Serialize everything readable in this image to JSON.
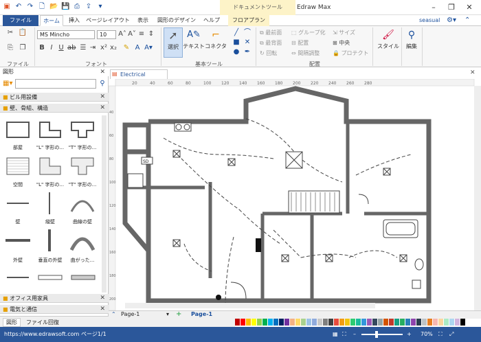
{
  "titlebar": {
    "doc_tools": "ドキュメントツール",
    "app_title": "Edraw Max",
    "user": "seasual"
  },
  "tabs": [
    "ファイル",
    "ホーム",
    "挿入",
    "ページレイアウト",
    "表示",
    "図形のデザイン",
    "ヘルプ",
    "フロアプラン"
  ],
  "ribbon": {
    "font_name": "MS Mincho",
    "font_size": "10",
    "select_label": "選択",
    "text_label": "テキスト",
    "connector_label": "コネクタ",
    "arrange": [
      "最前面",
      "グループ化",
      "サイズ",
      "最背面",
      "配置",
      "中央",
      "回転",
      "間隔調整",
      "プロテクト"
    ],
    "style_label": "スタイル",
    "edit_label": "編集",
    "groups": {
      "file": "ファイル",
      "font": "フォント",
      "basic": "基本ツール",
      "arrange": "配置"
    }
  },
  "left_panel": {
    "title": "図形",
    "search_placeholder": "",
    "cat1": "ビル用設備",
    "cat2": "壁、骨組、構造",
    "shapes": [
      "部屋",
      "\"L\" 字形の...",
      "\"T\" 字形の...",
      "空間",
      "\"L\" 字形の...",
      "\"T\" 字形の...",
      "壁",
      "縦壁",
      "曲線の壁",
      "外壁",
      "垂直の外壁",
      "曲がった..."
    ],
    "cat3": "オフィス用家具",
    "cat4": "電気と通信",
    "bottom_tabs": [
      "図形",
      "ファイル回復"
    ]
  },
  "canvas": {
    "doc_tab": "Electrical Plan",
    "ruler_h": [
      "20",
      "40",
      "60",
      "80",
      "100",
      "120",
      "140",
      "160",
      "180",
      "200",
      "220",
      "240",
      "260",
      "280"
    ],
    "ruler_v": [
      "40",
      "60",
      "80",
      "100",
      "120",
      "140",
      "160",
      "180",
      "200"
    ]
  },
  "pages": {
    "page_select": "Page-1",
    "page_tab": "Page-1",
    "add": "+"
  },
  "status": {
    "url": "https://www.edrawsoft.com",
    "page": "ページ1/1",
    "zoom": "70%"
  },
  "colors": {
    "ribbon_blue": "#2b579a",
    "doc_tools_bg": "#fdf3c8"
  }
}
